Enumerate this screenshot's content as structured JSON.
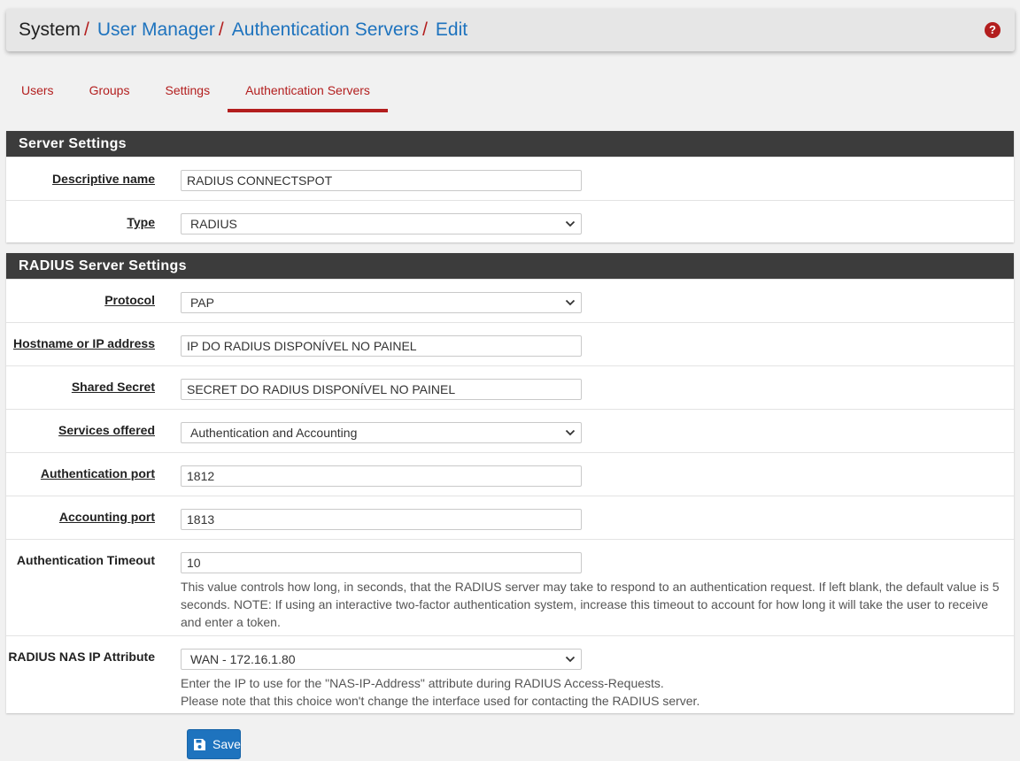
{
  "breadcrumb": {
    "root": "System",
    "items": [
      "User Manager",
      "Authentication Servers",
      "Edit"
    ],
    "separator": "/"
  },
  "help_icon": "question-circle-icon",
  "tabs": [
    {
      "label": "Users",
      "active": false
    },
    {
      "label": "Groups",
      "active": false
    },
    {
      "label": "Settings",
      "active": false
    },
    {
      "label": "Authentication Servers",
      "active": true
    }
  ],
  "server_settings": {
    "heading": "Server Settings",
    "descriptive_name": {
      "label": "Descriptive name",
      "value": "RADIUS CONNECTSPOT"
    },
    "type": {
      "label": "Type",
      "value": "RADIUS"
    }
  },
  "radius_settings": {
    "heading": "RADIUS Server Settings",
    "protocol": {
      "label": "Protocol",
      "value": "PAP"
    },
    "hostname": {
      "label": "Hostname or IP address",
      "value": "IP DO RADIUS DISPONÍVEL NO PAINEL"
    },
    "shared_secret": {
      "label": "Shared Secret",
      "value": "SECRET DO RADIUS DISPONÍVEL NO PAINEL"
    },
    "services": {
      "label": "Services offered",
      "value": "Authentication and Accounting"
    },
    "auth_port": {
      "label": "Authentication port",
      "value": "1812"
    },
    "acct_port": {
      "label": "Accounting port",
      "value": "1813"
    },
    "timeout": {
      "label": "Authentication Timeout",
      "value": "10",
      "help_line1": "This value controls how long, in seconds, that the RADIUS server may take to respond to an authentication request. If left blank, the default value is 5",
      "help_line2": "seconds. NOTE: If using an interactive two-factor authentication system, increase this timeout to account for how long it will take the user to receive",
      "help_line3": "and enter a token."
    },
    "nas_ip": {
      "label": "RADIUS NAS IP Attribute",
      "value": "WAN - 172.16.1.80",
      "help_line1": "Enter the IP to use for the \"NAS-IP-Address\" attribute during RADIUS Access-Requests.",
      "help_line2": "Please note that this choice won't change the interface used for contacting the RADIUS server."
    }
  },
  "save_button": {
    "label": "Save",
    "icon": "floppy-disk-icon"
  },
  "colors": {
    "accent_red": "#b31e1e",
    "link_blue": "#1e73be",
    "panel_heading": "#3c3c3c"
  }
}
